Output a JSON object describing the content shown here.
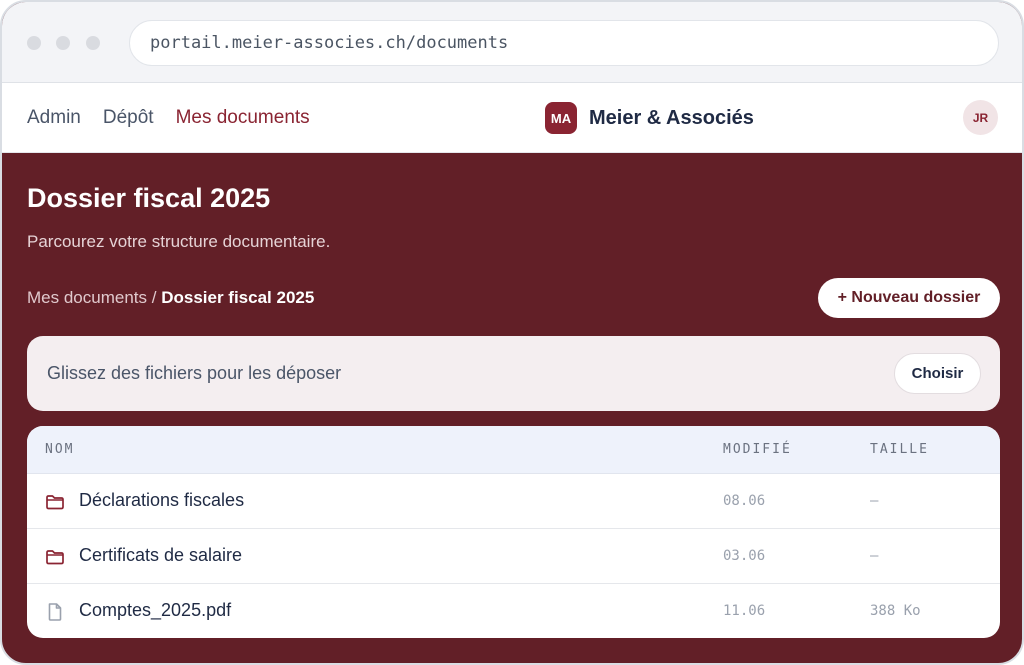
{
  "browser": {
    "url": "portail.meier-associes.ch/documents"
  },
  "header": {
    "nav": [
      "Admin",
      "Dépôt",
      "Mes documents"
    ],
    "brand_logo": "MA",
    "brand_name": "Meier & Associés",
    "avatar_initials": "JR",
    "accent_color": "#8a2432"
  },
  "main": {
    "title": "Dossier fiscal 2025",
    "subtitle": "Parcourez votre structure documentaire.",
    "breadcrumb": {
      "parent": "Mes documents",
      "separator": "/",
      "current": "Dossier fiscal 2025"
    },
    "new_folder_label": "+ Nouveau dossier",
    "background_color": "#621f27"
  },
  "dropzone": {
    "text": "Glissez des fichiers pour les déposer",
    "button_label": "Choisir"
  },
  "table": {
    "headers": [
      "NOM",
      "MODIFIÉ",
      "TAILLE"
    ],
    "rows": [
      {
        "icon": "folder-icon",
        "name": "Déclarations fiscales",
        "modified": "08.06",
        "size": "—"
      },
      {
        "icon": "folder-icon",
        "name": "Certificats de salaire",
        "modified": "03.06",
        "size": "—"
      },
      {
        "icon": "file-icon",
        "name": "Comptes_2025.pdf",
        "modified": "11.06",
        "size": "388 Ko"
      }
    ]
  }
}
